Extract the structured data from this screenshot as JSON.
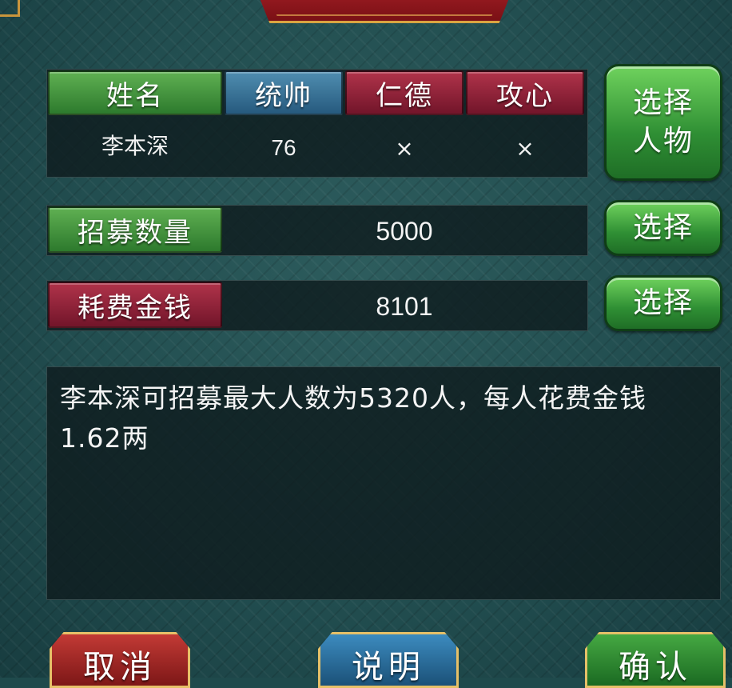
{
  "table": {
    "headers": [
      "姓名",
      "统帅",
      "仁德",
      "攻心"
    ],
    "row": [
      "李本深",
      "76",
      "×",
      "×"
    ]
  },
  "select_character_button": [
    "选择",
    "人物"
  ],
  "recruit": {
    "label": "招募数量",
    "value": "5000",
    "button": "选择"
  },
  "cost": {
    "label": "耗费金钱",
    "value": "8101",
    "button": "选择"
  },
  "description": "李本深可招募最大人数为5320人，每人花费金钱1.62两",
  "buttons": {
    "cancel": "取消",
    "info": "说明",
    "confirm": "确认"
  },
  "colors": {
    "header_green": "#4a9a42",
    "header_blue": "#3a76a0",
    "header_red": "#9a2540",
    "button_green": "#3fae3f"
  }
}
